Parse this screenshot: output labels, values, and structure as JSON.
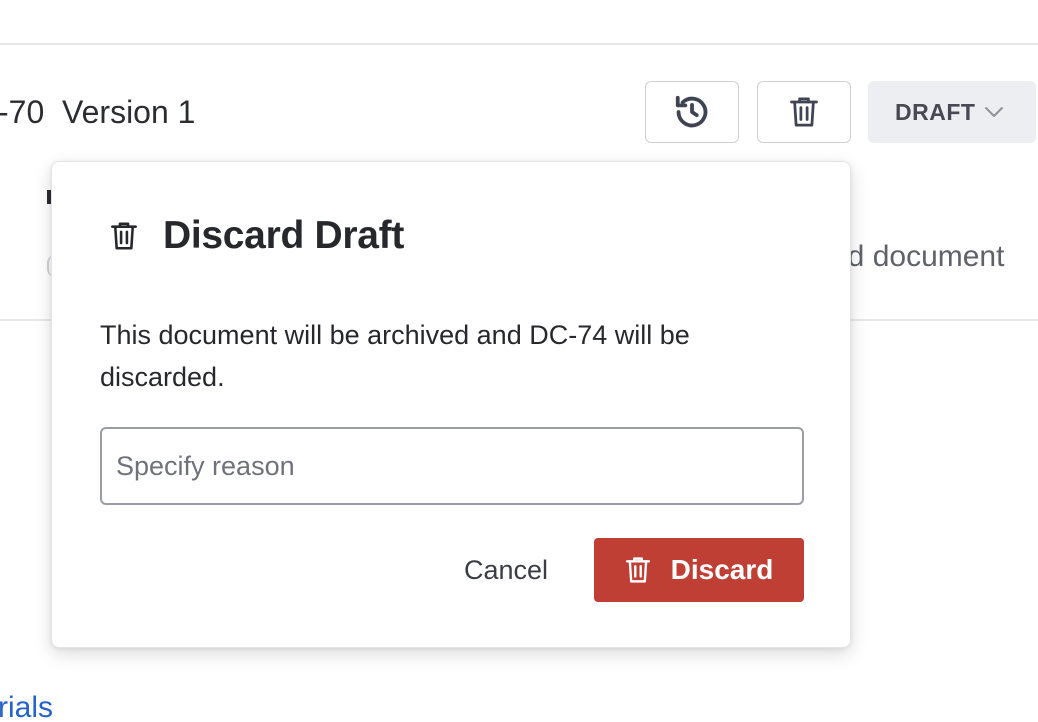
{
  "document": {
    "title_fragment": "-70  Version 1"
  },
  "toolbar": {
    "history_icon": "history-icon",
    "delete_icon": "trash-icon",
    "status_label": "DRAFT",
    "status_icon": "chevron-down-icon"
  },
  "background": {
    "doc_text_fragment": "ed document",
    "link_fragment": "rials"
  },
  "modal": {
    "title": "Discard Draft",
    "title_icon": "trash-icon",
    "message": "This document will be archived and DC-74 will be discarded.",
    "reason_placeholder": "Specify reason",
    "reason_value": "",
    "cancel_label": "Cancel",
    "discard_label": "Discard",
    "discard_icon": "trash-icon"
  },
  "colors": {
    "danger": "#bf3f35",
    "link": "#2563c9",
    "status_bg": "#eceef1",
    "icon": "#3f4452"
  }
}
